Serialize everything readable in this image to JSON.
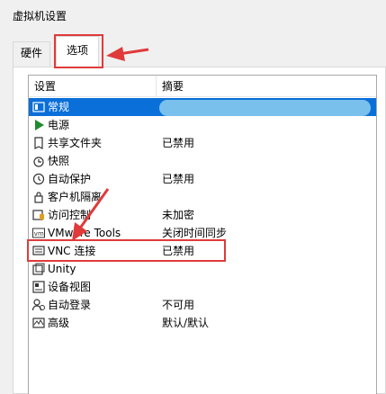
{
  "window": {
    "title": "虚拟机设置"
  },
  "tabs": [
    {
      "label": "硬件"
    },
    {
      "label": "选项"
    }
  ],
  "list": {
    "headers": [
      "设置",
      "摘要"
    ],
    "rows": [
      {
        "icon": "general-icon",
        "name": "常规",
        "summary": ""
      },
      {
        "icon": "power-icon",
        "name": "电源",
        "summary": ""
      },
      {
        "icon": "shared-folders-icon",
        "name": "共享文件夹",
        "summary": "已禁用"
      },
      {
        "icon": "snapshot-icon",
        "name": "快照",
        "summary": ""
      },
      {
        "icon": "autoprotect-icon",
        "name": "自动保护",
        "summary": "已禁用"
      },
      {
        "icon": "lock-icon",
        "name": "客户机隔离",
        "summary": ""
      },
      {
        "icon": "access-control-icon",
        "name": "访问控制",
        "summary": "未加密"
      },
      {
        "icon": "vmware-tools-icon",
        "name": "VMware Tools",
        "summary": "关闭时间同步"
      },
      {
        "icon": "vnc-icon",
        "name": "VNC 连接",
        "summary": "已禁用"
      },
      {
        "icon": "unity-icon",
        "name": "Unity",
        "summary": ""
      },
      {
        "icon": "device-view-icon",
        "name": "设备视图",
        "summary": ""
      },
      {
        "icon": "autologin-icon",
        "name": "自动登录",
        "summary": "不可用"
      },
      {
        "icon": "advanced-icon",
        "name": "高级",
        "summary": "默认/默认"
      }
    ]
  },
  "colors": {
    "selection": "#0a6fd8",
    "annotation": "#e03a3a"
  }
}
